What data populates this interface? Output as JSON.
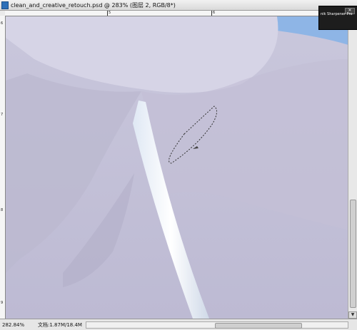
{
  "titlebar": {
    "text": "clean_and_creative_retouch.psd @ 283% (图层 2, RGB/8*)"
  },
  "rulers": {
    "top_marks": [
      "5",
      "6"
    ],
    "left_marks": [
      "6",
      "7",
      "8",
      "9"
    ]
  },
  "status": {
    "zoom": "282.84%",
    "doc": "文档:1.87M/18.4M"
  },
  "popup": {
    "title": "nik Sharpener Pro"
  },
  "colors": {
    "skin": "#c4c2d8",
    "background_sky": "#8eb5e6"
  }
}
